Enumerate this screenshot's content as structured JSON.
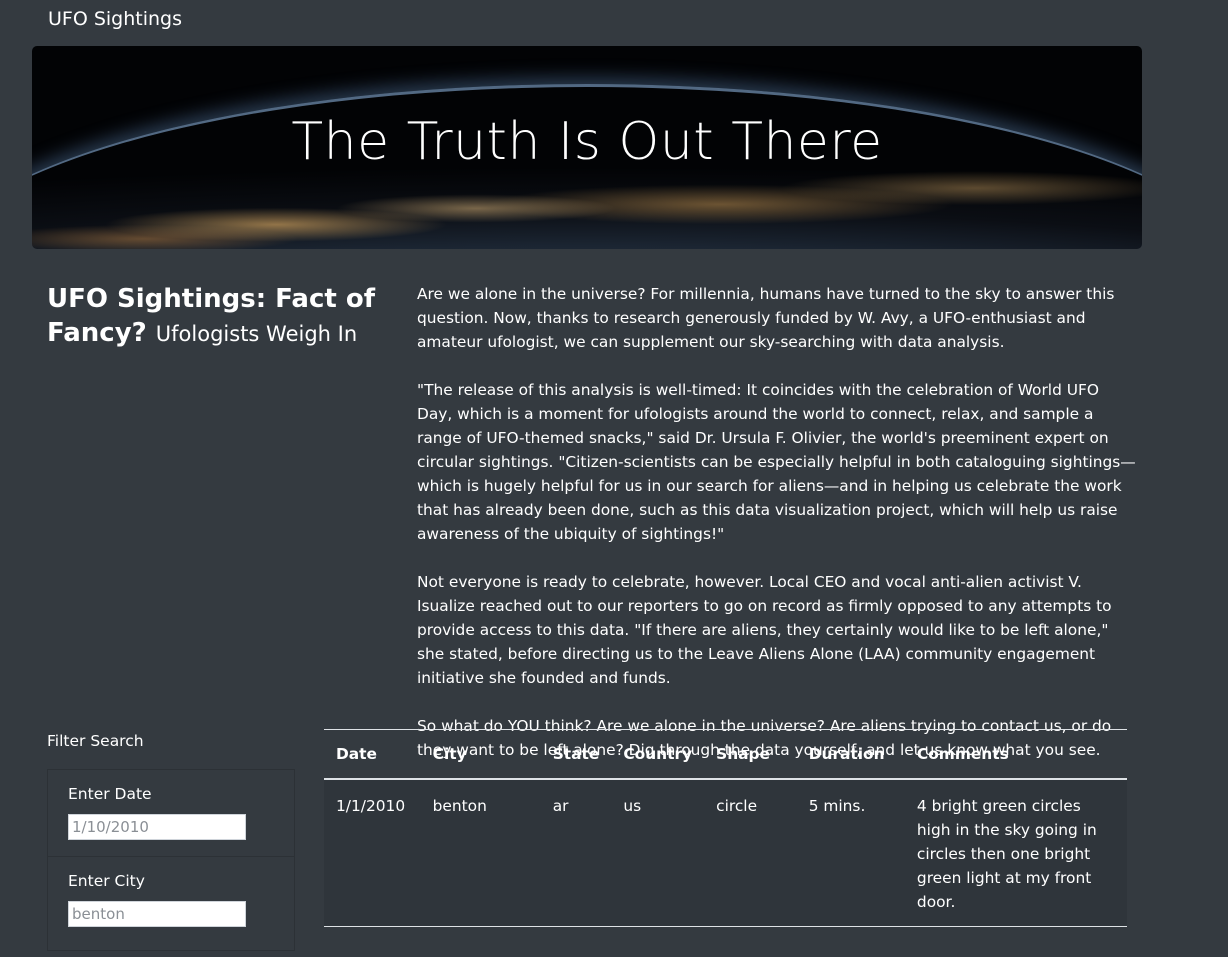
{
  "navbar": {
    "brand": "UFO Sightings"
  },
  "hero": {
    "title": "The Truth Is Out There"
  },
  "headline": {
    "title": "UFO Sightings: Fact of Fancy?",
    "subtitle": "Ufologists Weigh In"
  },
  "article": {
    "paragraphs": [
      "Are we alone in the universe? For millennia, humans have turned to the sky to answer this question. Now, thanks to research generously funded by W. Avy, a UFO-enthusiast and amateur ufologist, we can supplement our sky-searching with data analysis.",
      "\"The release of this analysis is well-timed: It coincides with the celebration of World UFO Day, which is a moment for ufologists around the world to connect, relax, and sample a range of UFO-themed snacks,\" said Dr. Ursula F. Olivier, the world's preeminent expert on circular sightings. \"Citizen-scientists can be especially helpful in both cataloguing sightings—which is hugely helpful for us in our search for aliens—and in helping us celebrate the work that has already been done, such as this data visualization project, which will help us raise awareness of the ubiquity of sightings!\"",
      "Not everyone is ready to celebrate, however. Local CEO and vocal anti-alien activist V. Isualize reached out to our reporters to go on record as firmly opposed to any attempts to provide access to this data. \"If there are aliens, they certainly would like to be left alone,\" she stated, before directing us to the Leave Aliens Alone (LAA) community engagement initiative she founded and funds.",
      "So what do YOU think? Are we alone in the universe? Are aliens trying to contact us, or do they want to be left alone? Dig through the data yourself, and let us know what you see."
    ]
  },
  "filters": {
    "title": "Filter Search",
    "date": {
      "label": "Enter Date",
      "placeholder": "1/10/2010"
    },
    "city": {
      "label": "Enter City",
      "placeholder": "benton"
    }
  },
  "table": {
    "headers": [
      "Date",
      "City",
      "State",
      "Country",
      "Shape",
      "Duration",
      "Comments"
    ],
    "rows": [
      [
        "1/1/2010",
        "benton",
        "ar",
        "us",
        "circle",
        "5 mins.",
        "4 bright green circles high in the sky going in circles then one bright green light at my front door."
      ]
    ]
  }
}
